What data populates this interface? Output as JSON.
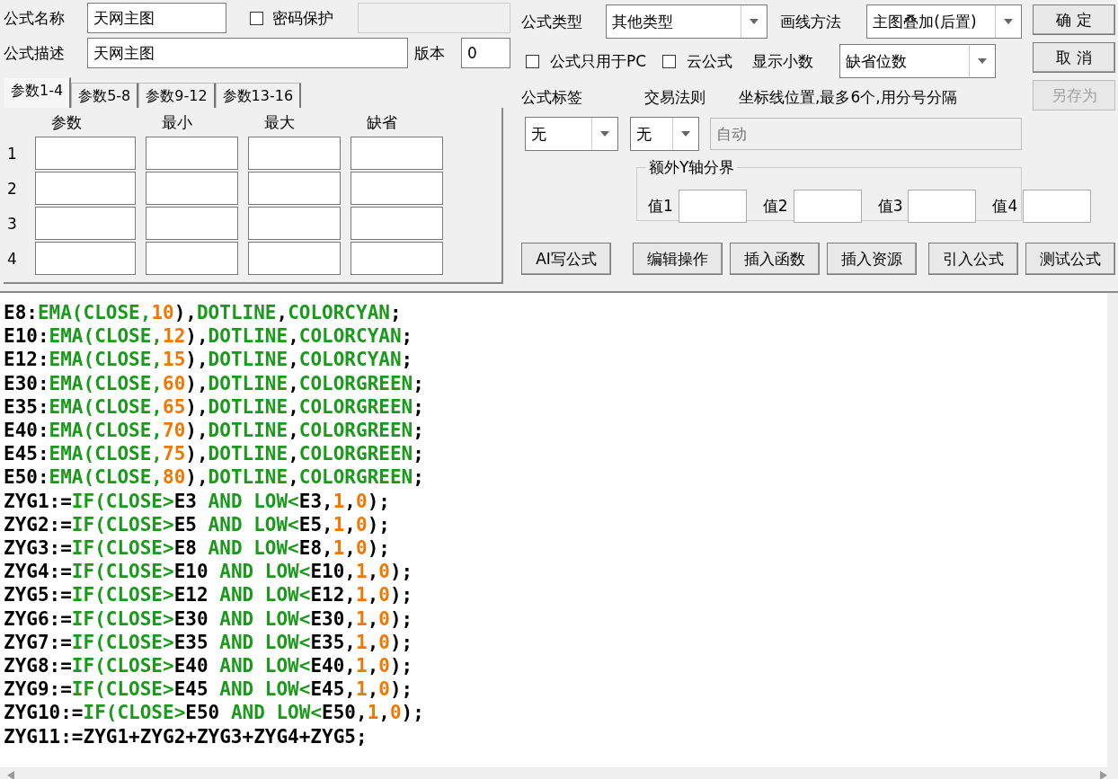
{
  "formula": {
    "name_label": "公式名称",
    "name": "天网主图",
    "password": {
      "label": "密码保护",
      "checked": false
    },
    "desc_label": "公式描述",
    "desc": "天网主图",
    "version_label": "版本",
    "version": "0"
  },
  "param_tabs": [
    {
      "label": "参数1-4",
      "selected": true
    },
    {
      "label": "参数5-8",
      "selected": false
    },
    {
      "label": "参数9-12",
      "selected": false
    },
    {
      "label": "参数13-16",
      "selected": false
    }
  ],
  "param_table": {
    "columns": [
      "参数",
      "最小",
      "最大",
      "缺省"
    ],
    "rows": [
      "1",
      "2",
      "3",
      "4"
    ]
  },
  "settings": {
    "type": {
      "label": "公式类型",
      "value": "其他类型"
    },
    "draw": {
      "label": "画线方法",
      "value": "主图叠加(后置)"
    },
    "pc_only": {
      "label": "公式只用于PC",
      "checked": false
    },
    "cloud": {
      "label": "云公式",
      "checked": false
    },
    "decimals": {
      "label": "显示小数",
      "value": "缺省位数"
    },
    "tag": {
      "label": "公式标签",
      "value": "无"
    },
    "rule": {
      "label": "交易法则",
      "value": "无"
    },
    "axis": {
      "label": "坐标线位置,最多6个,用分号分隔",
      "placeholder": "自动"
    },
    "y_bounds": {
      "title": "额外Y轴分界",
      "fields": [
        "值1",
        "值2",
        "值3",
        "值4"
      ]
    }
  },
  "side_buttons": [
    {
      "label": "确 定",
      "disabled": false
    },
    {
      "label": "取 消",
      "disabled": false
    },
    {
      "label": "另存为",
      "disabled": true
    }
  ],
  "tool_buttons": [
    "AI写公式",
    "编辑操作",
    "插入函数",
    "插入资源",
    "引入公式",
    "测试公式"
  ],
  "code": [
    [
      {
        "kind": "plain",
        "text": "E8:"
      },
      {
        "kind": "keyword",
        "text": "EMA(CLOSE,"
      },
      {
        "kind": "number",
        "text": "10"
      },
      {
        "kind": "plain",
        "text": "),"
      },
      {
        "kind": "keyword",
        "text": "DOTLINE"
      },
      {
        "kind": "plain",
        "text": ","
      },
      {
        "kind": "keyword",
        "text": "COLORCYAN"
      },
      {
        "kind": "plain",
        "text": ";"
      }
    ],
    [
      {
        "kind": "plain",
        "text": "E10:"
      },
      {
        "kind": "keyword",
        "text": "EMA(CLOSE,"
      },
      {
        "kind": "number",
        "text": "12"
      },
      {
        "kind": "plain",
        "text": "),"
      },
      {
        "kind": "keyword",
        "text": "DOTLINE"
      },
      {
        "kind": "plain",
        "text": ","
      },
      {
        "kind": "keyword",
        "text": "COLORCYAN"
      },
      {
        "kind": "plain",
        "text": ";"
      }
    ],
    [
      {
        "kind": "plain",
        "text": "E12:"
      },
      {
        "kind": "keyword",
        "text": "EMA(CLOSE,"
      },
      {
        "kind": "number",
        "text": "15"
      },
      {
        "kind": "plain",
        "text": "),"
      },
      {
        "kind": "keyword",
        "text": "DOTLINE"
      },
      {
        "kind": "plain",
        "text": ","
      },
      {
        "kind": "keyword",
        "text": "COLORCYAN"
      },
      {
        "kind": "plain",
        "text": ";"
      }
    ],
    [
      {
        "kind": "plain",
        "text": "E30:"
      },
      {
        "kind": "keyword",
        "text": "EMA(CLOSE,"
      },
      {
        "kind": "number",
        "text": "60"
      },
      {
        "kind": "plain",
        "text": "),"
      },
      {
        "kind": "keyword",
        "text": "DOTLINE"
      },
      {
        "kind": "plain",
        "text": ","
      },
      {
        "kind": "keyword",
        "text": "COLORGREEN"
      },
      {
        "kind": "plain",
        "text": ";"
      }
    ],
    [
      {
        "kind": "plain",
        "text": "E35:"
      },
      {
        "kind": "keyword",
        "text": "EMA(CLOSE,"
      },
      {
        "kind": "number",
        "text": "65"
      },
      {
        "kind": "plain",
        "text": "),"
      },
      {
        "kind": "keyword",
        "text": "DOTLINE"
      },
      {
        "kind": "plain",
        "text": ","
      },
      {
        "kind": "keyword",
        "text": "COLORGREEN"
      },
      {
        "kind": "plain",
        "text": ";"
      }
    ],
    [
      {
        "kind": "plain",
        "text": "E40:"
      },
      {
        "kind": "keyword",
        "text": "EMA(CLOSE,"
      },
      {
        "kind": "number",
        "text": "70"
      },
      {
        "kind": "plain",
        "text": "),"
      },
      {
        "kind": "keyword",
        "text": "DOTLINE"
      },
      {
        "kind": "plain",
        "text": ","
      },
      {
        "kind": "keyword",
        "text": "COLORGREEN"
      },
      {
        "kind": "plain",
        "text": ";"
      }
    ],
    [
      {
        "kind": "plain",
        "text": "E45:"
      },
      {
        "kind": "keyword",
        "text": "EMA(CLOSE,"
      },
      {
        "kind": "number",
        "text": "75"
      },
      {
        "kind": "plain",
        "text": "),"
      },
      {
        "kind": "keyword",
        "text": "DOTLINE"
      },
      {
        "kind": "plain",
        "text": ","
      },
      {
        "kind": "keyword",
        "text": "COLORGREEN"
      },
      {
        "kind": "plain",
        "text": ";"
      }
    ],
    [
      {
        "kind": "plain",
        "text": "E50:"
      },
      {
        "kind": "keyword",
        "text": "EMA(CLOSE,"
      },
      {
        "kind": "number",
        "text": "80"
      },
      {
        "kind": "plain",
        "text": "),"
      },
      {
        "kind": "keyword",
        "text": "DOTLINE"
      },
      {
        "kind": "plain",
        "text": ","
      },
      {
        "kind": "keyword",
        "text": "COLORGREEN"
      },
      {
        "kind": "plain",
        "text": ";"
      }
    ],
    [
      {
        "kind": "plain",
        "text": "ZYG1:="
      },
      {
        "kind": "keyword",
        "text": "IF(CLOSE>"
      },
      {
        "kind": "plain",
        "text": "E3 "
      },
      {
        "kind": "keyword",
        "text": "AND LOW<"
      },
      {
        "kind": "plain",
        "text": "E3,"
      },
      {
        "kind": "number",
        "text": "1"
      },
      {
        "kind": "plain",
        "text": ","
      },
      {
        "kind": "number",
        "text": "0"
      },
      {
        "kind": "plain",
        "text": ");"
      }
    ],
    [
      {
        "kind": "plain",
        "text": "ZYG2:="
      },
      {
        "kind": "keyword",
        "text": "IF(CLOSE>"
      },
      {
        "kind": "plain",
        "text": "E5 "
      },
      {
        "kind": "keyword",
        "text": "AND LOW<"
      },
      {
        "kind": "plain",
        "text": "E5,"
      },
      {
        "kind": "number",
        "text": "1"
      },
      {
        "kind": "plain",
        "text": ","
      },
      {
        "kind": "number",
        "text": "0"
      },
      {
        "kind": "plain",
        "text": ");"
      }
    ],
    [
      {
        "kind": "plain",
        "text": "ZYG3:="
      },
      {
        "kind": "keyword",
        "text": "IF(CLOSE>"
      },
      {
        "kind": "plain",
        "text": "E8 "
      },
      {
        "kind": "keyword",
        "text": "AND LOW<"
      },
      {
        "kind": "plain",
        "text": "E8,"
      },
      {
        "kind": "number",
        "text": "1"
      },
      {
        "kind": "plain",
        "text": ","
      },
      {
        "kind": "number",
        "text": "0"
      },
      {
        "kind": "plain",
        "text": ");"
      }
    ],
    [
      {
        "kind": "plain",
        "text": "ZYG4:="
      },
      {
        "kind": "keyword",
        "text": "IF(CLOSE>"
      },
      {
        "kind": "plain",
        "text": "E10 "
      },
      {
        "kind": "keyword",
        "text": "AND LOW<"
      },
      {
        "kind": "plain",
        "text": "E10,"
      },
      {
        "kind": "number",
        "text": "1"
      },
      {
        "kind": "plain",
        "text": ","
      },
      {
        "kind": "number",
        "text": "0"
      },
      {
        "kind": "plain",
        "text": ");"
      }
    ],
    [
      {
        "kind": "plain",
        "text": "ZYG5:="
      },
      {
        "kind": "keyword",
        "text": "IF(CLOSE>"
      },
      {
        "kind": "plain",
        "text": "E12 "
      },
      {
        "kind": "keyword",
        "text": "AND LOW<"
      },
      {
        "kind": "plain",
        "text": "E12,"
      },
      {
        "kind": "number",
        "text": "1"
      },
      {
        "kind": "plain",
        "text": ","
      },
      {
        "kind": "number",
        "text": "0"
      },
      {
        "kind": "plain",
        "text": ");"
      }
    ],
    [
      {
        "kind": "plain",
        "text": "ZYG6:="
      },
      {
        "kind": "keyword",
        "text": "IF(CLOSE>"
      },
      {
        "kind": "plain",
        "text": "E30 "
      },
      {
        "kind": "keyword",
        "text": "AND LOW<"
      },
      {
        "kind": "plain",
        "text": "E30,"
      },
      {
        "kind": "number",
        "text": "1"
      },
      {
        "kind": "plain",
        "text": ","
      },
      {
        "kind": "number",
        "text": "0"
      },
      {
        "kind": "plain",
        "text": ");"
      }
    ],
    [
      {
        "kind": "plain",
        "text": "ZYG7:="
      },
      {
        "kind": "keyword",
        "text": "IF(CLOSE>"
      },
      {
        "kind": "plain",
        "text": "E35 "
      },
      {
        "kind": "keyword",
        "text": "AND LOW<"
      },
      {
        "kind": "plain",
        "text": "E35,"
      },
      {
        "kind": "number",
        "text": "1"
      },
      {
        "kind": "plain",
        "text": ","
      },
      {
        "kind": "number",
        "text": "0"
      },
      {
        "kind": "plain",
        "text": ");"
      }
    ],
    [
      {
        "kind": "plain",
        "text": "ZYG8:="
      },
      {
        "kind": "keyword",
        "text": "IF(CLOSE>"
      },
      {
        "kind": "plain",
        "text": "E40 "
      },
      {
        "kind": "keyword",
        "text": "AND LOW<"
      },
      {
        "kind": "plain",
        "text": "E40,"
      },
      {
        "kind": "number",
        "text": "1"
      },
      {
        "kind": "plain",
        "text": ","
      },
      {
        "kind": "number",
        "text": "0"
      },
      {
        "kind": "plain",
        "text": ");"
      }
    ],
    [
      {
        "kind": "plain",
        "text": "ZYG9:="
      },
      {
        "kind": "keyword",
        "text": "IF(CLOSE>"
      },
      {
        "kind": "plain",
        "text": "E45 "
      },
      {
        "kind": "keyword",
        "text": "AND LOW<"
      },
      {
        "kind": "plain",
        "text": "E45,"
      },
      {
        "kind": "number",
        "text": "1"
      },
      {
        "kind": "plain",
        "text": ","
      },
      {
        "kind": "number",
        "text": "0"
      },
      {
        "kind": "plain",
        "text": ");"
      }
    ],
    [
      {
        "kind": "plain",
        "text": "ZYG10:="
      },
      {
        "kind": "keyword",
        "text": "IF(CLOSE>"
      },
      {
        "kind": "plain",
        "text": "E50 "
      },
      {
        "kind": "keyword",
        "text": "AND LOW<"
      },
      {
        "kind": "plain",
        "text": "E50,"
      },
      {
        "kind": "number",
        "text": "1"
      },
      {
        "kind": "plain",
        "text": ","
      },
      {
        "kind": "number",
        "text": "0"
      },
      {
        "kind": "plain",
        "text": ");"
      }
    ],
    [
      {
        "kind": "plain",
        "text": "ZYG11:=ZYG1+ZYG2+ZYG3+ZYG4+ZYG5;"
      }
    ]
  ]
}
